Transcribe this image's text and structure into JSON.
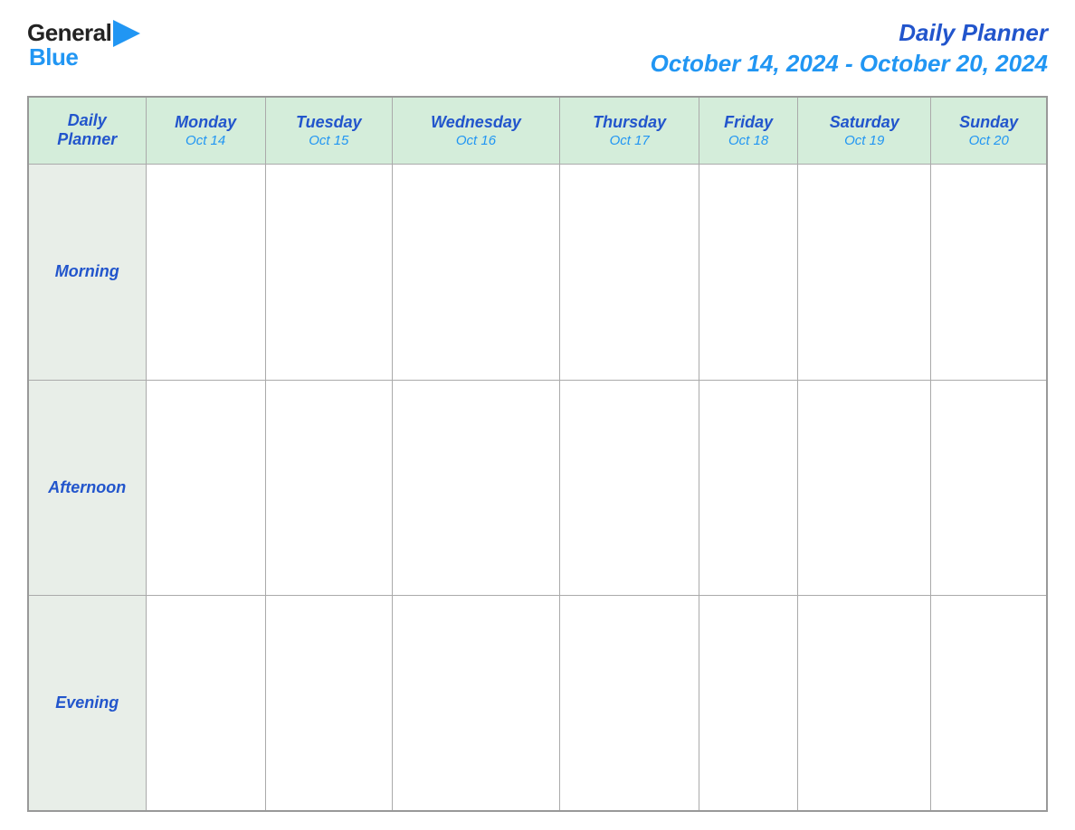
{
  "header": {
    "logo": {
      "text_general": "General",
      "text_blue": "Blue"
    },
    "title_line1": "Daily Planner",
    "title_line2": "October 14, 2024 - October 20, 2024"
  },
  "table": {
    "columns": [
      {
        "day": "Daily",
        "day2": "Planner",
        "date": ""
      },
      {
        "day": "Monday",
        "date": "Oct 14"
      },
      {
        "day": "Tuesday",
        "date": "Oct 15"
      },
      {
        "day": "Wednesday",
        "date": "Oct 16"
      },
      {
        "day": "Thursday",
        "date": "Oct 17"
      },
      {
        "day": "Friday",
        "date": "Oct 18"
      },
      {
        "day": "Saturday",
        "date": "Oct 19"
      },
      {
        "day": "Sunday",
        "date": "Oct 20"
      }
    ],
    "rows": [
      {
        "label": "Morning"
      },
      {
        "label": "Afternoon"
      },
      {
        "label": "Evening"
      }
    ]
  }
}
